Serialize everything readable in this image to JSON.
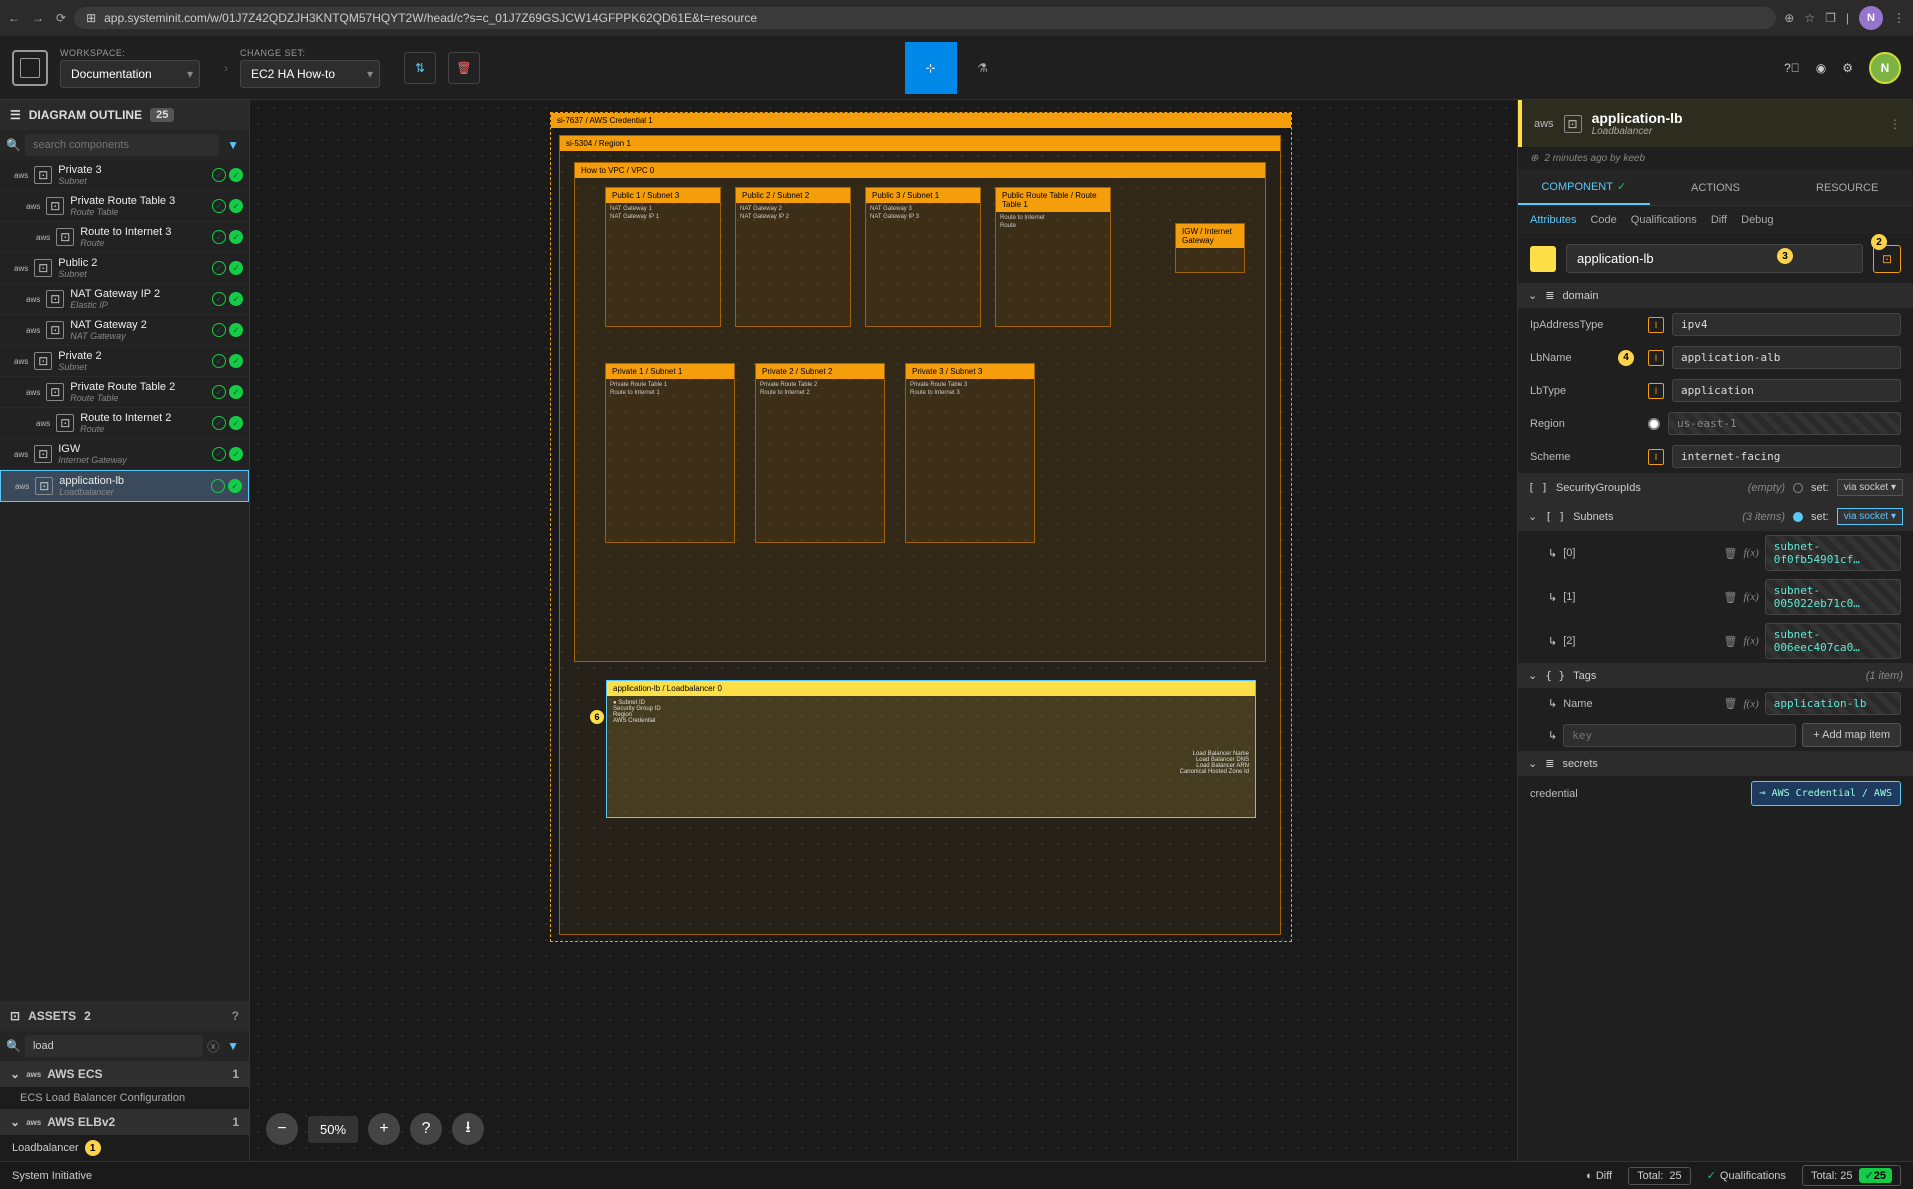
{
  "browser": {
    "url": "app.systeminit.com/w/01J7Z42QDZJH3KNTQM57HQYT2W/head/c?s=c_01J7Z69GSJCW14GFPPK62QD61E&t=resource",
    "avatar": "N"
  },
  "toolbar": {
    "workspace_label": "WORKSPACE:",
    "workspace_value": "Documentation",
    "changeset_label": "CHANGE SET:",
    "changeset_value": "EC2 HA How-to",
    "avatar": "N"
  },
  "outline": {
    "title": "DIAGRAM OUTLINE",
    "count": "25",
    "search_placeholder": "search components",
    "items": [
      {
        "name": "Private 3",
        "type": "Subnet",
        "indent": 0,
        "aws": true
      },
      {
        "name": "Private Route Table 3",
        "type": "Route Table",
        "indent": 1,
        "aws": true
      },
      {
        "name": "Route to Internet 3",
        "type": "Route",
        "indent": 2,
        "aws": true
      },
      {
        "name": "Public 2",
        "type": "Subnet",
        "indent": 0,
        "aws": true
      },
      {
        "name": "NAT Gateway IP 2",
        "type": "Elastic IP",
        "indent": 1,
        "aws": true
      },
      {
        "name": "NAT Gateway 2",
        "type": "NAT Gateway",
        "indent": 1,
        "aws": true
      },
      {
        "name": "Private 2",
        "type": "Subnet",
        "indent": 0,
        "aws": true
      },
      {
        "name": "Private Route Table 2",
        "type": "Route Table",
        "indent": 1,
        "aws": true
      },
      {
        "name": "Route to Internet 2",
        "type": "Route",
        "indent": 2,
        "aws": true
      },
      {
        "name": "IGW",
        "type": "Internet Gateway",
        "indent": 0,
        "aws": true
      },
      {
        "name": "application-lb",
        "type": "Loadbalancer",
        "indent": 0,
        "aws": true,
        "selected": true
      }
    ]
  },
  "assets": {
    "title": "ASSETS",
    "count": "2",
    "search_value": "load",
    "groups": [
      {
        "name": "AWS ECS",
        "count": "1",
        "sub": "ECS Load Balancer Configuration"
      },
      {
        "name": "AWS ELBv2",
        "count": "1",
        "leaf": "Loadbalancer",
        "badge": "1"
      }
    ]
  },
  "canvas": {
    "zoom": "50%",
    "root_label": "si-7637 / AWS Credential 1",
    "region_label": "si-5304 / Region 1",
    "vpc_label": "How to VPC / VPC 0",
    "publics": [
      "Public 1 / Subnet 3",
      "Public 2 / Subnet 2",
      "Public 3 / Subnet 1",
      "Public Route Table / Route Table 1"
    ],
    "nat_boxes": [
      "NAT Gateway 1",
      "NAT Gateway 2",
      "NAT Gateway 3",
      "Route to Internet"
    ],
    "nat_ips": [
      "NAT Gateway IP 1",
      "NAT Gateway IP 2",
      "NAT Gateway IP 3"
    ],
    "igw": "IGW / Internet Gateway",
    "privates": [
      "Private 1 / Subnet 1",
      "Private 2 / Subnet 2",
      "Private 3 / Subnet 3"
    ],
    "private_rt": [
      "Private Route Table 1",
      "Private Route Table 2",
      "Private Route Table 3"
    ],
    "route_int": [
      "Route to Internet 1",
      "Route to Internet 2",
      "Route to Internet 3"
    ],
    "lb": {
      "name": "application-lb / Loadbalancer 0",
      "left": [
        "Subnet ID",
        "Security Group ID",
        "Region",
        "AWS Credential"
      ],
      "right": [
        "Load Balancer Name",
        "Load Balancer DNS",
        "Load Balancer ARN",
        "Canonical Hosted Zone Id"
      ]
    },
    "dot6": "6"
  },
  "right": {
    "head_name": "application-lb",
    "head_type": "Loadbalancer",
    "timestamp": "2 minutes ago by keeb",
    "tabs": [
      "COMPONENT",
      "ACTIONS",
      "RESOURCE"
    ],
    "subtabs": [
      "Attributes",
      "Code",
      "Qualifications",
      "Diff",
      "Debug"
    ],
    "name_value": "application-lb",
    "badge2": "2",
    "badge3": "3",
    "badge4": "4",
    "domain": {
      "title": "domain",
      "IpAddressType": "ipv4",
      "LbName": "application-alb",
      "LbType": "application",
      "Region": "us-east-1",
      "Scheme": "internet-facing"
    },
    "securityGroupIds": {
      "label": "SecurityGroupIds",
      "empty": "(empty)",
      "set": "set:",
      "via": "via socket ▾"
    },
    "subnets": {
      "label": "Subnets",
      "count": "(3 items)",
      "set": "set:",
      "via": "via socket ▾",
      "items": [
        {
          "idx": "[0]",
          "val": "subnet-0f0fb54901cf…"
        },
        {
          "idx": "[1]",
          "val": "subnet-005022eb71c0…"
        },
        {
          "idx": "[2]",
          "val": "subnet-006eec407ca0…"
        }
      ]
    },
    "tags": {
      "label": "Tags",
      "count": "(1 item)",
      "name_key": "Name",
      "name_val": "application-lb",
      "key_placeholder": "key",
      "add_btn": "+ Add map item"
    },
    "secrets": {
      "label": "secrets",
      "cred_label": "credential",
      "cred_box": "⊸ AWS Credential / AWS"
    }
  },
  "footer": {
    "brand": "System Initiative",
    "diff": "Diff",
    "total_label": "Total:",
    "total_val": "25",
    "qual": "Qualifications",
    "qual_total": "Total: 25",
    "qual_pass": "25"
  }
}
